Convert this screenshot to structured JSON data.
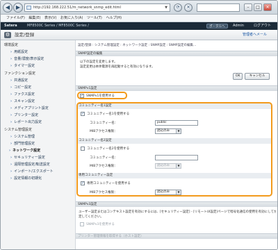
{
  "browser": {
    "url": "http://192.168.222.51/m_network_snmp_edit.html",
    "menu": [
      "ファイル(F)",
      "編集(E)",
      "表示(V)",
      "お気に入り(A)",
      "ツール(T)",
      "ヘルプ(H)"
    ],
    "back_icon": "back-arrow-icon",
    "forward_icon": "forward-arrow-icon"
  },
  "device": {
    "brand": "Satera",
    "model": "MF8500C Series / MF8500C Series /",
    "portal_label": "ポータルへ",
    "user_label": "Admin",
    "logout_label": "ログアウト"
  },
  "header": {
    "title": "設定/登録",
    "admin_link": "管理者へメール"
  },
  "sidebar": {
    "groups": [
      {
        "label": "環境設定",
        "items": [
          "用紙設定",
          "音量/濃度/表示設定",
          "タイマー設定"
        ]
      },
      {
        "label": "ファンクション設定",
        "items": [
          "共通設定",
          "コピー設定",
          "ファクス設定",
          "スキャン設定",
          "メディアプリント設定",
          "プリンター設定",
          "レポート出力設定"
        ]
      },
      {
        "label": "システム管理設定",
        "items": [
          "システム管理",
          "部門管理設定",
          "ネットワーク設定",
          "セキュリティー設定",
          "遠隔管理設定/転送設定",
          "インポート/エクスポート",
          "設定情報の初期化"
        ]
      }
    ],
    "active": "ネットワーク設定"
  },
  "content": {
    "breadcrumb": "設定/登録 : システム管理設定 : ネットワーク設定 : SNMP設定 : SNMP設定の編集...",
    "edit_header": "SNMP設定の編集",
    "edit_desc_1": "以下の設定を変更します。",
    "edit_desc_2": "設定変更は本体電源を再起動すると有効になります。",
    "ok_label": "OK",
    "cancel_label": "キャンセル",
    "v1_header": "SNMPv1設定",
    "v1_use_label": "SNMPv1を使用する",
    "v1_use_checked": true,
    "community1": {
      "header": "コミュニティー名1設定",
      "use_label": "コミュニティー名1を使用する",
      "use_checked": true,
      "name_label": "コミュニティー名：",
      "name_value": "public",
      "access_label": "MIBアクセス権限：",
      "access_value": "読込のみ"
    },
    "community2": {
      "header": "コミュニティー名2設定",
      "use_label": "コミュニティー名2を使用する",
      "use_checked": false,
      "name_label": "コミュニティー名：",
      "name_value": "",
      "access_label": "MIBアクセス権限：",
      "access_value": "読込のみ"
    },
    "dedicated": {
      "header": "専用コミュニティー設定",
      "use_label": "専用コミュニティーを使用する",
      "use_checked": true,
      "access_label": "MIBアクセス権限：",
      "access_value": "読込のみ"
    },
    "v3_header": "SNMPv3設定",
    "v3_desc_1": "ユーザー設定またはコンテキスト設定を有効にするには、[セキュリティー設定] - [リモートUI設定]ページで暗号化通信の使用を有効にしてから設",
    "v3_desc_2": "定してください。",
    "v3_use_label": "SNMPv3を使用する",
    "next_header": "プリンター管理情報を取得する（ホスト設定）"
  },
  "colors": {
    "highlight": "#f29a1c",
    "device_bar": "#1b2a38",
    "link": "#1b58a6"
  }
}
